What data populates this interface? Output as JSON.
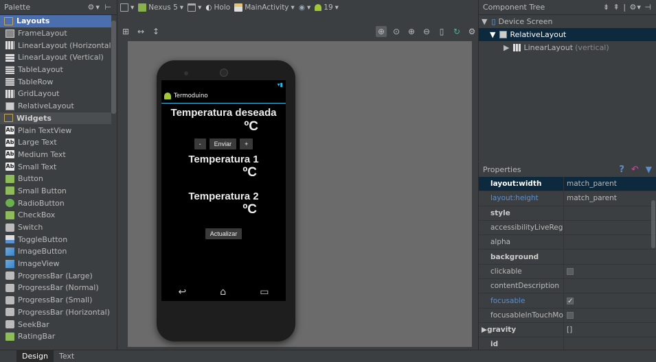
{
  "palette": {
    "title": "Palette",
    "items": [
      {
        "label": "Layouts",
        "kind": "category",
        "icon": "folder-icon"
      },
      {
        "label": "FrameLayout",
        "icon": "frame-layout-icon"
      },
      {
        "label": "LinearLayout (Horizontal)",
        "icon": "linear-layout-horizontal-icon"
      },
      {
        "label": "LinearLayout (Vertical)",
        "icon": "linear-layout-vertical-icon"
      },
      {
        "label": "TableLayout",
        "icon": "table-layout-icon"
      },
      {
        "label": "TableRow",
        "icon": "table-row-icon"
      },
      {
        "label": "GridLayout",
        "icon": "grid-layout-icon"
      },
      {
        "label": "RelativeLayout",
        "icon": "relative-layout-icon"
      },
      {
        "label": "Widgets",
        "kind": "category",
        "icon": "folder-icon"
      },
      {
        "label": "Plain TextView",
        "icon": "textview-icon"
      },
      {
        "label": "Large Text",
        "icon": "textview-icon"
      },
      {
        "label": "Medium Text",
        "icon": "textview-icon"
      },
      {
        "label": "Small Text",
        "icon": "textview-icon"
      },
      {
        "label": "Button",
        "icon": "button-icon"
      },
      {
        "label": "Small Button",
        "icon": "button-icon"
      },
      {
        "label": "RadioButton",
        "icon": "radio-button-icon"
      },
      {
        "label": "CheckBox",
        "icon": "checkbox-icon"
      },
      {
        "label": "Switch",
        "icon": "switch-icon"
      },
      {
        "label": "ToggleButton",
        "icon": "toggle-button-icon"
      },
      {
        "label": "ImageButton",
        "icon": "image-button-icon"
      },
      {
        "label": "ImageView",
        "icon": "image-view-icon"
      },
      {
        "label": "ProgressBar (Large)",
        "icon": "progress-bar-icon"
      },
      {
        "label": "ProgressBar (Normal)",
        "icon": "progress-bar-icon"
      },
      {
        "label": "ProgressBar (Small)",
        "icon": "progress-bar-icon"
      },
      {
        "label": "ProgressBar (Horizontal)",
        "icon": "progress-bar-icon"
      },
      {
        "label": "SeekBar",
        "icon": "seekbar-icon"
      },
      {
        "label": "RatingBar",
        "icon": "ratingbar-icon"
      }
    ]
  },
  "toolbar": {
    "device": "Nexus 5",
    "theme": "Holo",
    "activity": "MainActivity",
    "api": "19"
  },
  "device_screen": {
    "app_title": "Termoduino",
    "desired_label": "Temperatura deseada",
    "desired_unit": "ºC",
    "minus_label": "-",
    "send_label": "Enviar",
    "plus_label": "+",
    "temp1_label": "Temperatura 1",
    "temp1_unit": "ºC",
    "temp2_label": "Temperatura 2",
    "temp2_unit": "ºC",
    "update_label": "Actualizar"
  },
  "component_tree": {
    "title": "Component Tree",
    "root": "Device Screen",
    "child": "RelativeLayout",
    "grandchild": "LinearLayout",
    "grandchild_note": "(vertical)"
  },
  "properties": {
    "title": "Properties",
    "rows": [
      {
        "key": "layout:width",
        "value": "match_parent",
        "style": "sel"
      },
      {
        "key": "layout:height",
        "value": "match_parent",
        "style": "mod"
      },
      {
        "key": "style",
        "value": "",
        "style": "b"
      },
      {
        "key": "accessibilityLiveRegion",
        "value": "",
        "style": ""
      },
      {
        "key": "alpha",
        "value": "",
        "style": ""
      },
      {
        "key": "background",
        "value": "",
        "style": "b"
      },
      {
        "key": "clickable",
        "value": "",
        "style": "",
        "checkbox": "off"
      },
      {
        "key": "contentDescription",
        "value": "",
        "style": ""
      },
      {
        "key": "focusable",
        "value": "",
        "style": "mod",
        "checkbox": "on"
      },
      {
        "key": "focusableInTouchMod",
        "value": "",
        "style": "",
        "checkbox": "off"
      },
      {
        "key": "gravity",
        "value": "[]",
        "style": "b"
      },
      {
        "key": "id",
        "value": "",
        "style": "b"
      }
    ]
  },
  "bottom_tabs": {
    "design": "Design",
    "text": "Text"
  }
}
